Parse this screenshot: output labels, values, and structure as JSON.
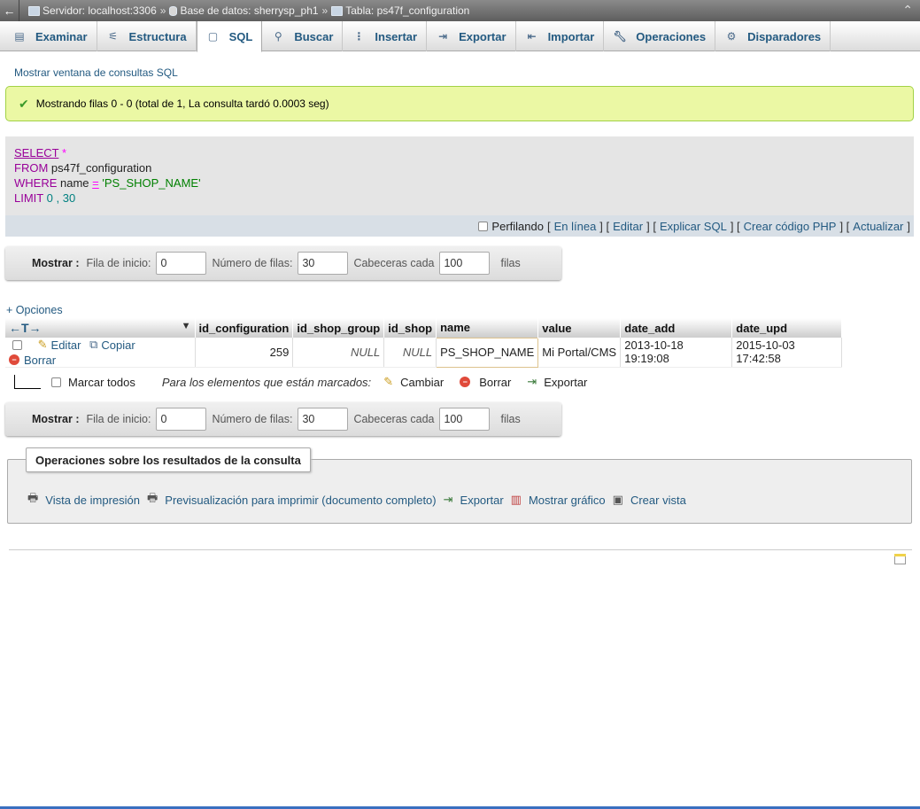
{
  "breadcrumb": {
    "server": "Servidor: localhost:3306",
    "database": "Base de datos: sherrysp_ph1",
    "table": "Tabla: ps47f_configuration",
    "separator": "»"
  },
  "tabs": [
    {
      "label": "Examinar",
      "icon": "table-browse-icon"
    },
    {
      "label": "Estructura",
      "icon": "structure-icon"
    },
    {
      "label": "SQL",
      "icon": "sql-icon",
      "active": true
    },
    {
      "label": "Buscar",
      "icon": "search-icon"
    },
    {
      "label": "Insertar",
      "icon": "insert-icon"
    },
    {
      "label": "Exportar",
      "icon": "export-icon"
    },
    {
      "label": "Importar",
      "icon": "import-icon"
    },
    {
      "label": "Operaciones",
      "icon": "wrench-icon"
    },
    {
      "label": "Disparadores",
      "icon": "triggers-icon"
    }
  ],
  "sql_window_link": "Mostrar ventana de consultas SQL",
  "success_message": "Mostrando filas 0 - 0 (total de 1, La consulta tardó 0.0003 seg)",
  "query": {
    "select": "SELECT",
    "star": "*",
    "from": "FROM",
    "table": "ps47f_configuration",
    "where": "WHERE",
    "column": "name",
    "eq": "=",
    "value": "'PS_SHOP_NAME'",
    "limit": "LIMIT",
    "offset": "0",
    "comma": ",",
    "count": "30"
  },
  "sql_tools": {
    "profiling": "Perfilando",
    "inline": "En línea",
    "edit": "Editar",
    "explain": "Explicar SQL",
    "php": "Crear código PHP",
    "refresh": "Actualizar"
  },
  "nav": {
    "show": "Mostrar :",
    "start_label": "Fila de inicio:",
    "start_value": "0",
    "rows_label": "Número de filas:",
    "rows_value": "30",
    "headers_label": "Cabeceras cada",
    "headers_value": "100",
    "rows_suffix": "filas"
  },
  "options_link": "+ Opciones",
  "table": {
    "arrows": "←T→",
    "sort_glyph": "▼",
    "columns": [
      "id_configuration",
      "id_shop_group",
      "id_shop",
      "name",
      "value",
      "date_add",
      "date_upd"
    ],
    "row": {
      "edit": "Editar",
      "copy": "Copiar",
      "delete": "Borrar",
      "id_configuration": "259",
      "id_shop_group": "NULL",
      "id_shop": "NULL",
      "name": "PS_SHOP_NAME",
      "value": "Mi Portal/CMS",
      "date_add": "2013-10-18 19:19:08",
      "date_upd": "2015-10-03 17:42:58"
    }
  },
  "bulk": {
    "check_all": "Marcar todos",
    "marked": "Para los elementos que están marcados:",
    "change": "Cambiar",
    "delete": "Borrar",
    "export": "Exportar"
  },
  "ops": {
    "legend": "Operaciones sobre los resultados de la consulta",
    "print": "Vista de impresión",
    "print_full": "Previsualización para imprimir (documento completo)",
    "export": "Exportar",
    "chart": "Mostrar gráfico",
    "view": "Crear vista"
  }
}
